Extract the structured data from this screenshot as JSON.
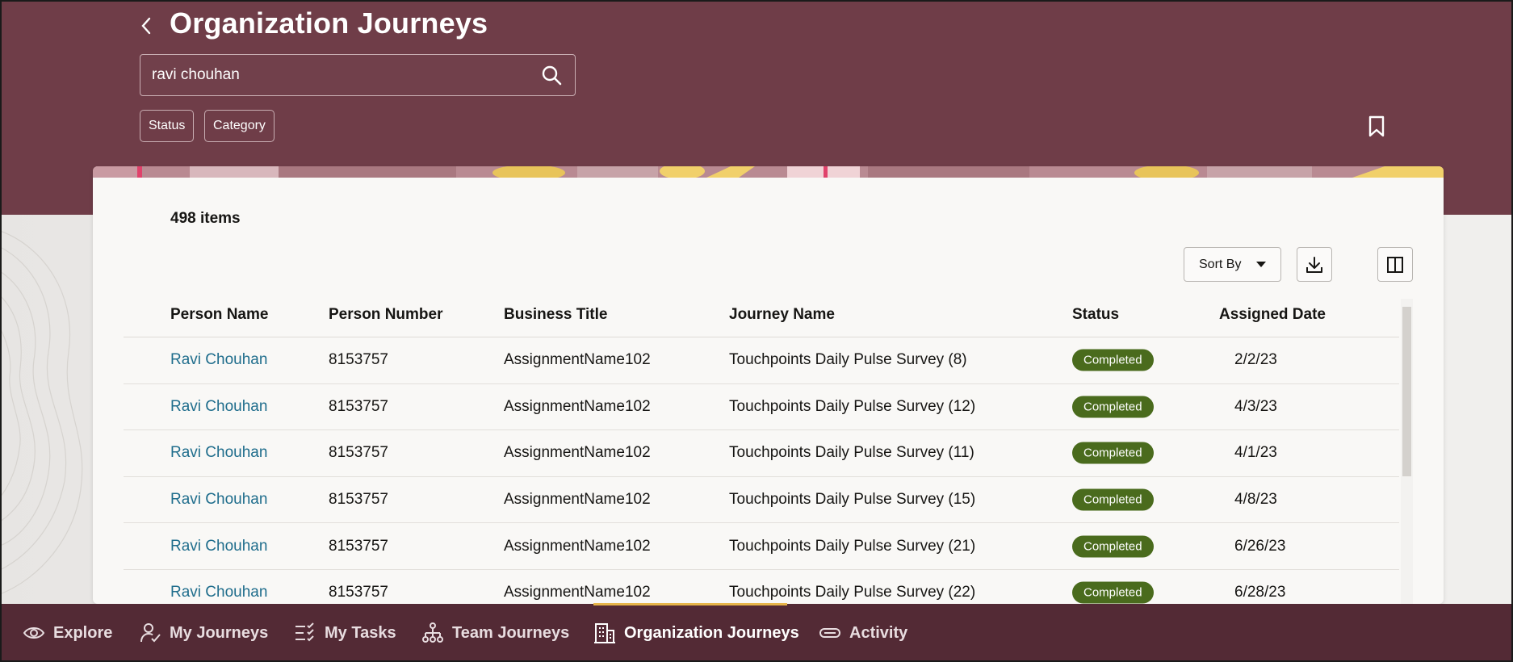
{
  "header": {
    "title": "Organization Journeys",
    "search_value": "ravi chouhan",
    "filters": [
      "Status",
      "Category"
    ]
  },
  "card": {
    "items_count": "498 items",
    "sort_label": "Sort By"
  },
  "table": {
    "columns": [
      "Person Name",
      "Person Number",
      "Business Title",
      "Journey Name",
      "Status",
      "Assigned Date"
    ],
    "rows": [
      {
        "name": "Ravi Chouhan",
        "number": "8153757",
        "title": "AssignmentName102",
        "journey": "Touchpoints Daily Pulse Survey (8)",
        "status": "Completed",
        "date": "2/2/23"
      },
      {
        "name": "Ravi Chouhan",
        "number": "8153757",
        "title": "AssignmentName102",
        "journey": "Touchpoints Daily Pulse Survey (12)",
        "status": "Completed",
        "date": "4/3/23"
      },
      {
        "name": "Ravi Chouhan",
        "number": "8153757",
        "title": "AssignmentName102",
        "journey": "Touchpoints Daily Pulse Survey (11)",
        "status": "Completed",
        "date": "4/1/23"
      },
      {
        "name": "Ravi Chouhan",
        "number": "8153757",
        "title": "AssignmentName102",
        "journey": "Touchpoints Daily Pulse Survey (15)",
        "status": "Completed",
        "date": "4/8/23"
      },
      {
        "name": "Ravi Chouhan",
        "number": "8153757",
        "title": "AssignmentName102",
        "journey": "Touchpoints Daily Pulse Survey (21)",
        "status": "Completed",
        "date": "6/26/23"
      },
      {
        "name": "Ravi Chouhan",
        "number": "8153757",
        "title": "AssignmentName102",
        "journey": "Touchpoints Daily Pulse Survey (22)",
        "status": "Completed",
        "date": "6/28/23"
      }
    ]
  },
  "nav": {
    "items": [
      {
        "label": "Explore",
        "icon": "eye-icon"
      },
      {
        "label": "My Journeys",
        "icon": "person-check-icon"
      },
      {
        "label": "My Tasks",
        "icon": "task-list-icon"
      },
      {
        "label": "Team Journeys",
        "icon": "org-chart-icon"
      },
      {
        "label": "Organization Journeys",
        "icon": "building-icon"
      },
      {
        "label": "Activity",
        "icon": "activity-icon"
      }
    ],
    "active": "Organization Journeys"
  },
  "colors": {
    "header": "#6f3d48",
    "nav": "#532a35",
    "badge": "#4a6b1d",
    "link": "#1f6d8c",
    "indicator": "#e7b54a"
  }
}
